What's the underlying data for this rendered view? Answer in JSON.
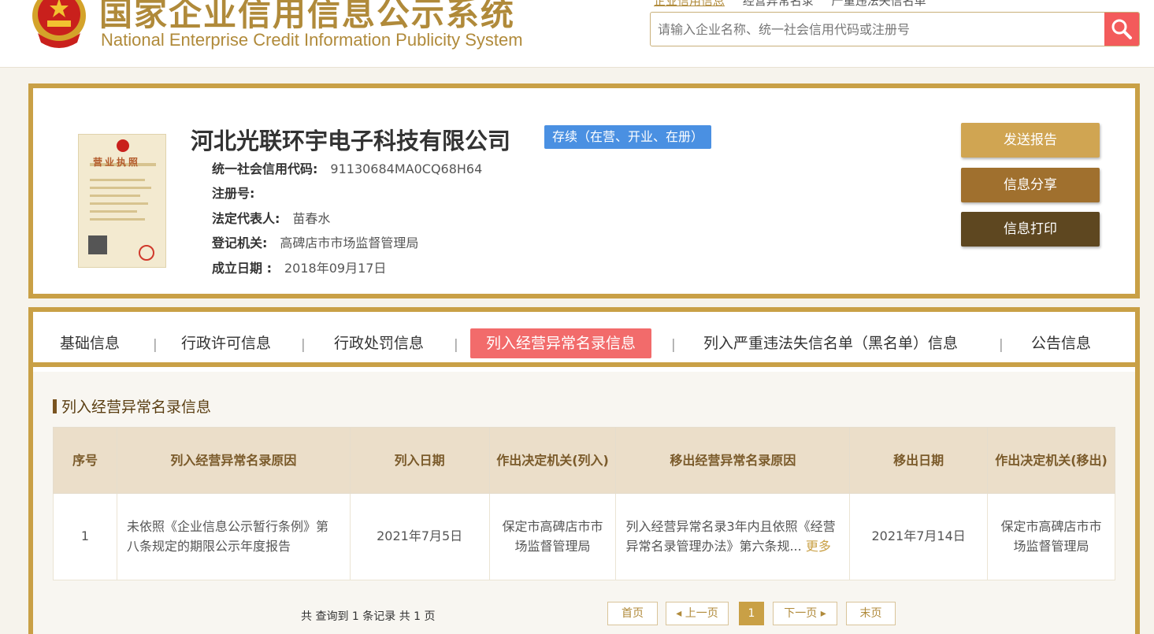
{
  "header": {
    "title_cn": "国家企业信用信息公示系统",
    "title_en": "National Enterprise Credit Information Publicity System",
    "top_links": [
      "企业信用信息",
      "经营异常名录",
      "严重违法失信名单"
    ],
    "search_placeholder": "请输入企业名称、统一社会信用代码或注册号",
    "accent_color": "#b08a3a"
  },
  "company": {
    "name": "河北光联环宇电子科技有限公司",
    "status": "存续（在营、开业、在册）",
    "fields": [
      {
        "label": "统一社会信用代码:",
        "value": "91130684MA0CQ68H64"
      },
      {
        "label": "注册号:",
        "value": ""
      },
      {
        "label": "法定代表人:",
        "value": "苗春水"
      },
      {
        "label": "登记机关:",
        "value": "高碑店市市场监督管理局"
      },
      {
        "label": "成立日期 :",
        "value": "2018年09月17日"
      }
    ],
    "license_caption": "营业执照",
    "actions": [
      {
        "label": "发送报告",
        "color": "#d0a552"
      },
      {
        "label": "信息分享",
        "color": "#a0702e"
      },
      {
        "label": "信息打印",
        "color": "#5e4720"
      }
    ]
  },
  "tabs": [
    "基础信息",
    "行政许可信息",
    "行政处罚信息",
    "列入经营异常名录信息",
    "列入严重违法失信名单（黑名单）信息",
    "公告信息"
  ],
  "active_tab_index": 3,
  "section": {
    "title": "列入经营异常名录信息",
    "columns": [
      "序号",
      "列入经营异常名录原因",
      "列入日期",
      "作出决定机关(列入)",
      "移出经营异常名录原因",
      "移出日期",
      "作出决定机关(移出)"
    ],
    "rows": [
      {
        "no": "1",
        "reason_in": "未依照《企业信息公示暂行条例》第八条规定的期限公示年度报告",
        "date_in": "2021年7月5日",
        "authority_in": "保定市高碑店市市场监督管理局",
        "reason_out": "列入经营异常名录3年内且依照《经营异常名录管理办法》第六条规...",
        "more": "更多",
        "date_out": "2021年7月14日",
        "authority_out": "保定市高碑店市市场监督管理局"
      }
    ]
  },
  "pager": {
    "info": "共 查询到 1 条记录 共 1 页",
    "first": "首页",
    "prev": "上一页",
    "current": "1",
    "next": "下一页",
    "last": "末页"
  }
}
